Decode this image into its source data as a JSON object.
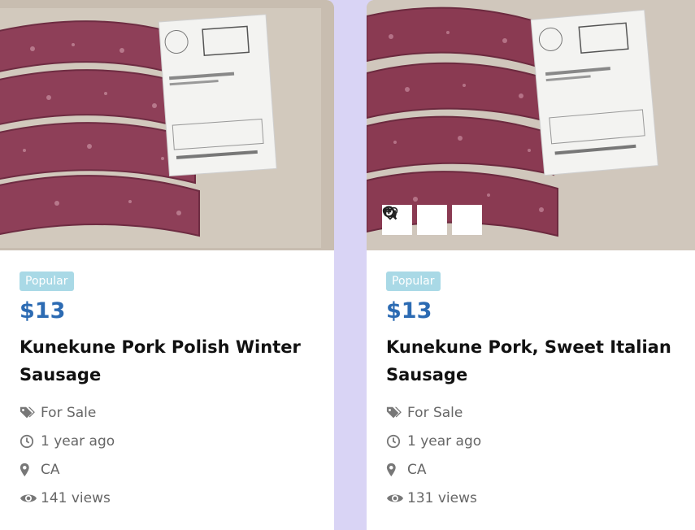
{
  "listings": [
    {
      "badge": "Popular",
      "price": "$13",
      "title": "Kunekune Pork Polish Winter Sausage",
      "status": "For Sale",
      "posted": "1 year ago",
      "location": "CA",
      "views": "141 views"
    },
    {
      "badge": "Popular",
      "price": "$13",
      "title": "Kunekune Pork, Sweet Italian Sausage",
      "status": "For Sale",
      "posted": "1 year ago",
      "location": "CA",
      "views": "131 views",
      "actions": [
        "heart-icon",
        "zoom-in-icon",
        "retweet-icon"
      ]
    }
  ],
  "colors": {
    "accent_price": "#2c6bb3",
    "badge_bg": "#a9d9e6",
    "page_bg": "#d9d4f5"
  }
}
